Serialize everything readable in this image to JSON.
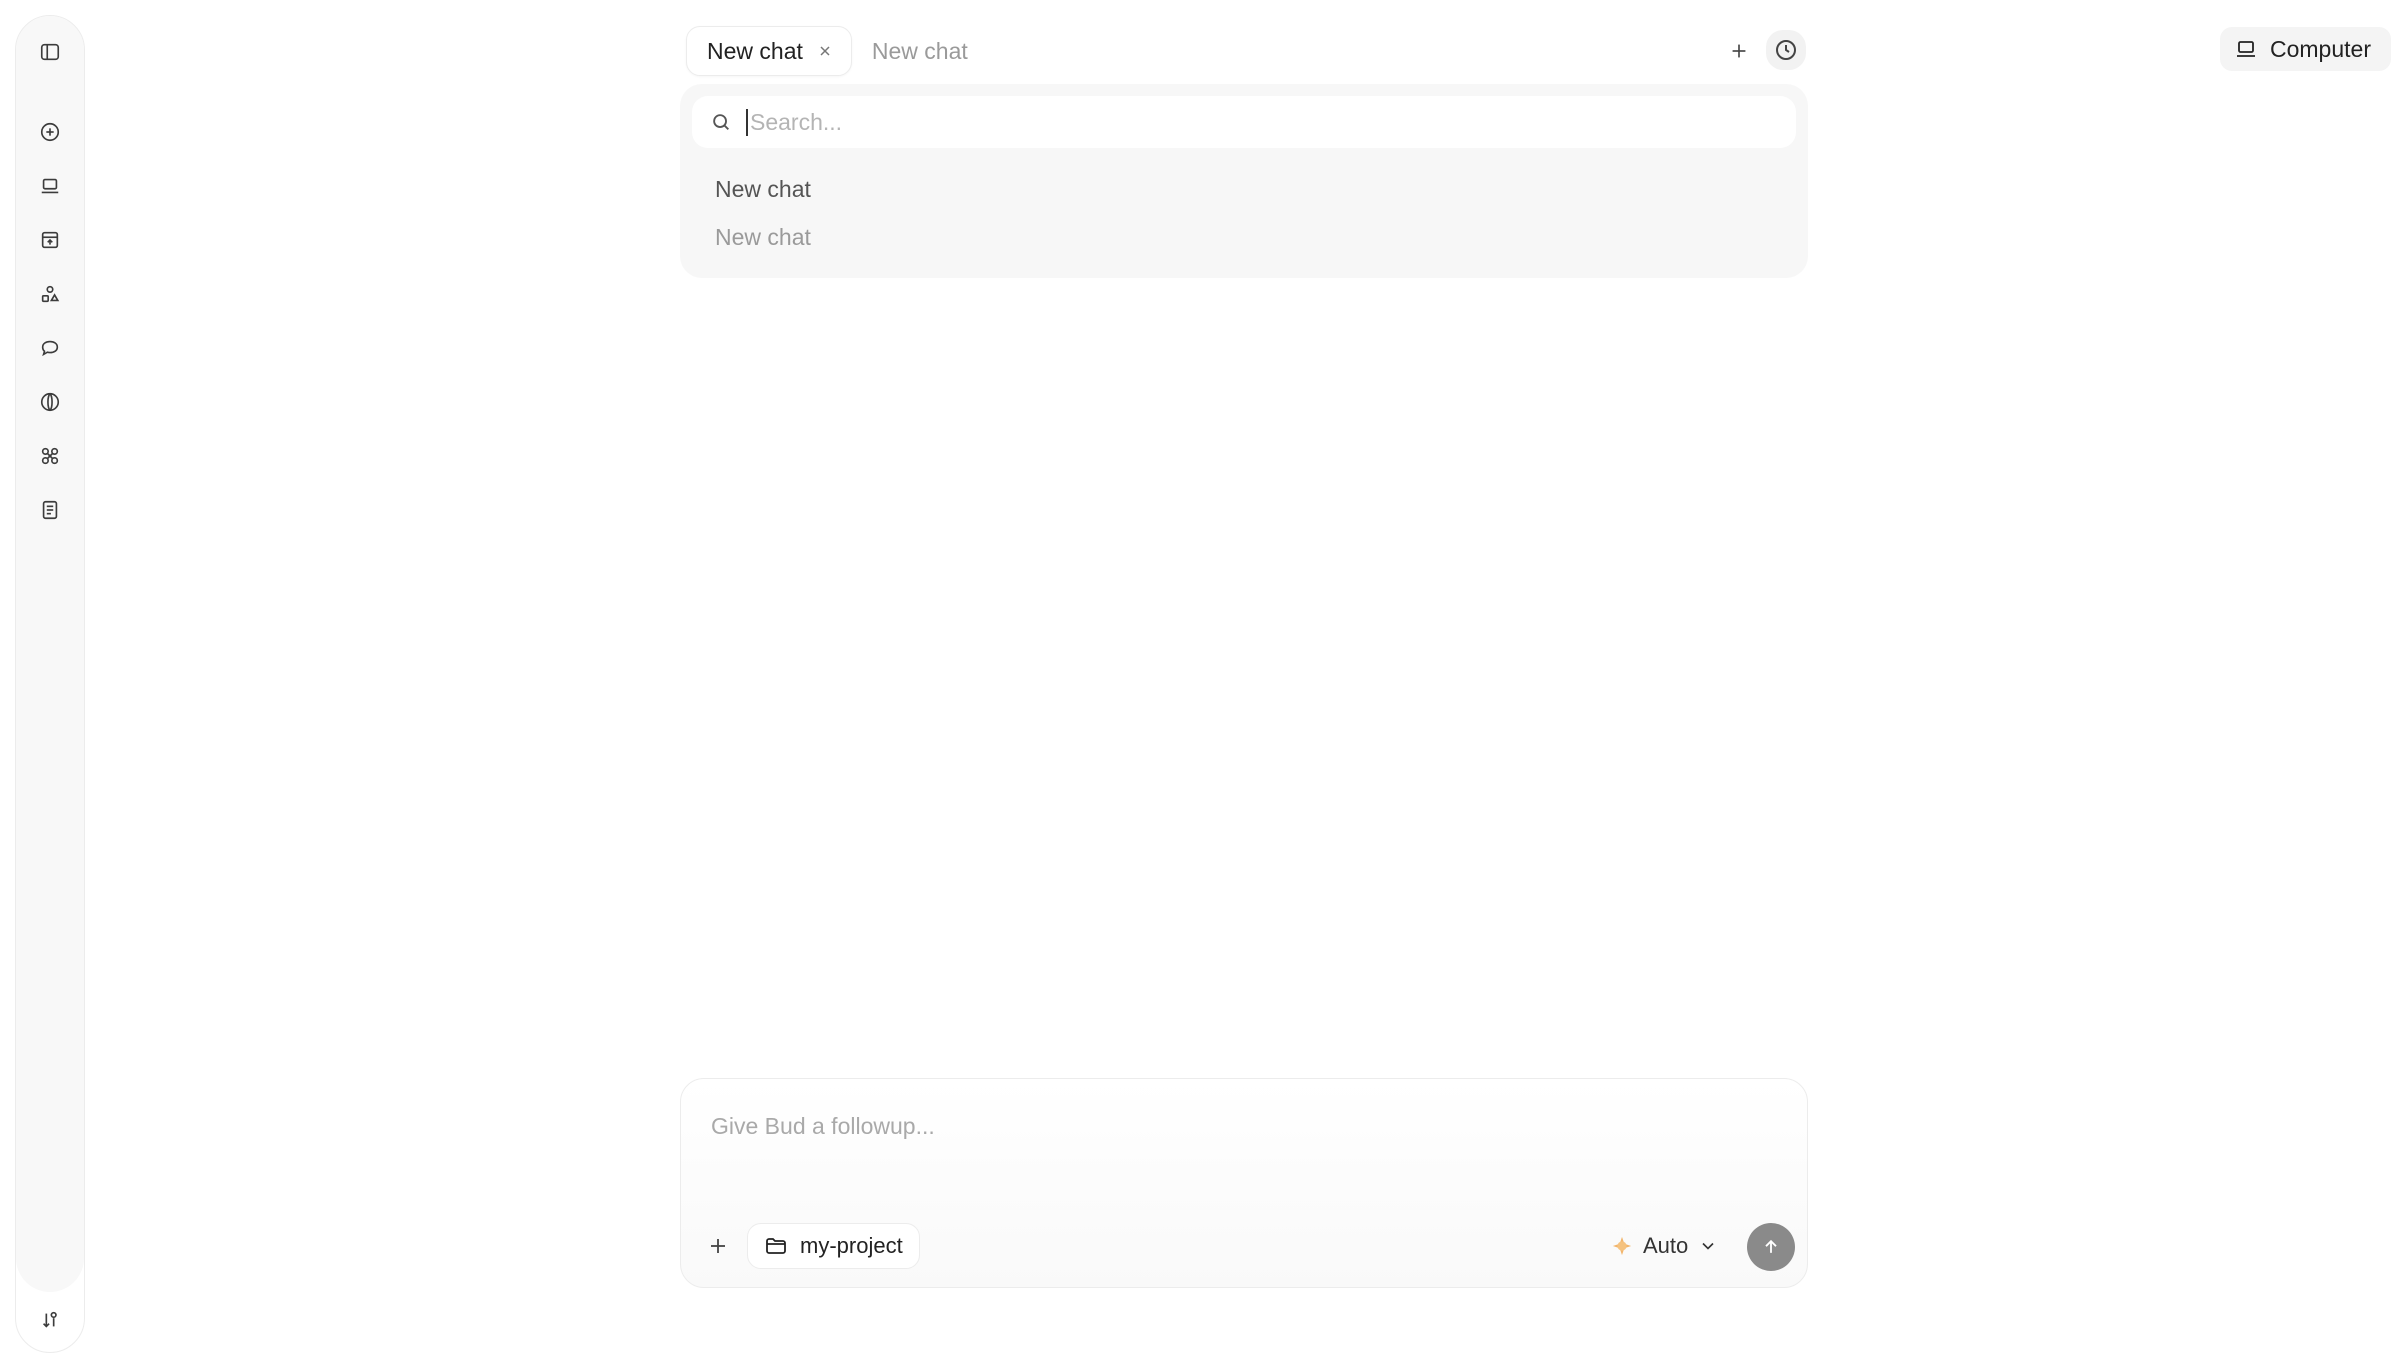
{
  "tabs": [
    {
      "label": "New chat",
      "active": true
    },
    {
      "label": "New chat",
      "active": false
    }
  ],
  "header": {
    "computer_label": "Computer"
  },
  "dropdown": {
    "search_placeholder": "Search...",
    "items": [
      {
        "label": "New chat"
      },
      {
        "label": "New chat"
      }
    ]
  },
  "composer": {
    "placeholder": "Give Bud a followup...",
    "project_label": "my-project",
    "model_label": "Auto"
  },
  "sidebar": {
    "icons": [
      "toggle-sidebar-icon",
      "new-chat-icon",
      "laptop-icon",
      "archive-icon",
      "shapes-icon",
      "chat-bubble-icon",
      "globe-icon",
      "connections-icon",
      "notebook-icon",
      "settings-icon"
    ]
  },
  "colors": {
    "accent_model": "#f2b46a",
    "send_button": "#8a8a8a"
  }
}
